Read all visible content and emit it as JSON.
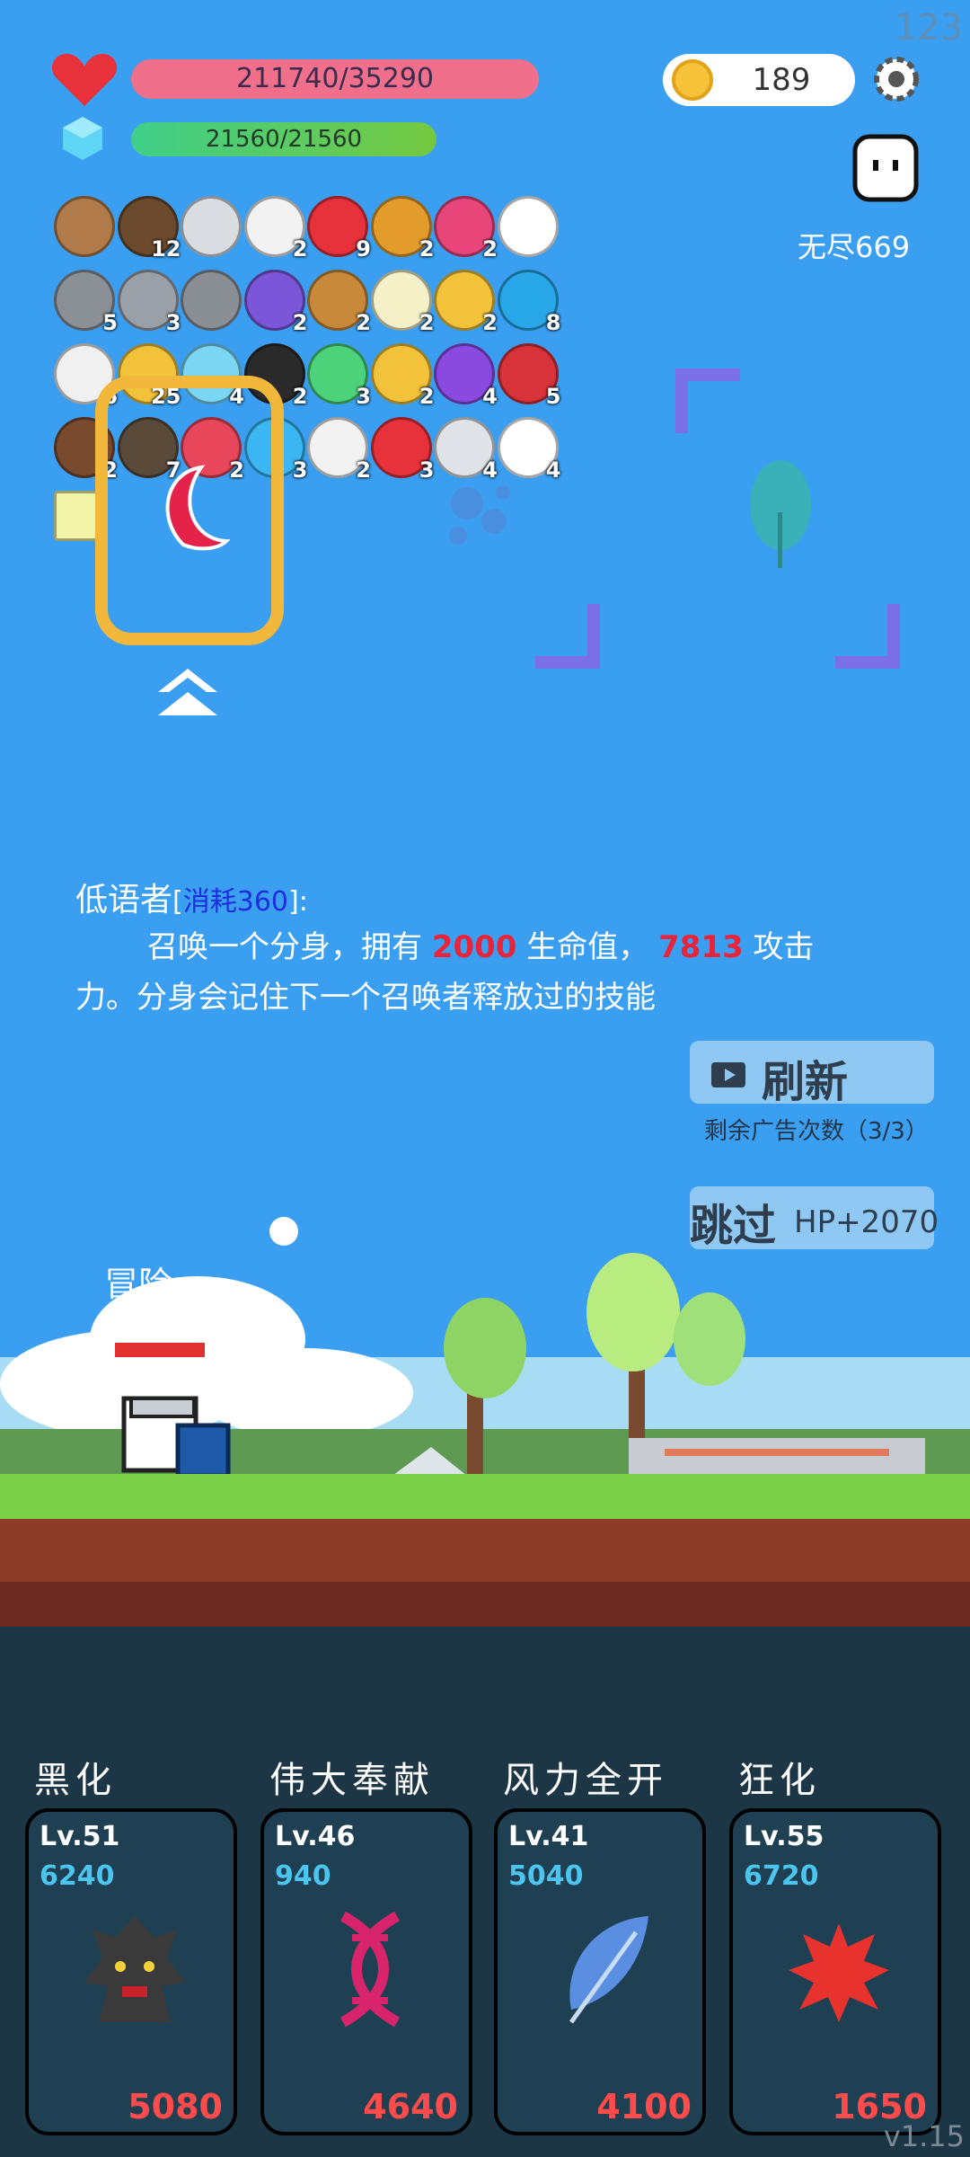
{
  "corner_number": "123",
  "hud": {
    "hp": "211740/35290",
    "mp": "21560/21560",
    "coins": "189",
    "endless": "无尽669"
  },
  "inventory": {
    "rows": [
      [
        {
          "icon": "shield-icon",
          "count": ""
        },
        {
          "icon": "coconut-icon",
          "count": "12"
        },
        {
          "icon": "sword-icon",
          "count": ""
        },
        {
          "icon": "envelope-icon",
          "count": "2"
        },
        {
          "icon": "strawberry-icon",
          "count": "9"
        },
        {
          "icon": "book-icon",
          "count": "2"
        },
        {
          "icon": "jam-jar-icon",
          "count": "2"
        },
        {
          "icon": "snowflake-icon",
          "count": ""
        }
      ],
      [
        {
          "icon": "tombstone-icon",
          "count": "5"
        },
        {
          "icon": "spiked-mace-icon",
          "count": "3"
        },
        {
          "icon": "helmet-icon",
          "count": ""
        },
        {
          "icon": "purple-chest-icon",
          "count": "2"
        },
        {
          "icon": "bow-icon",
          "count": "2"
        },
        {
          "icon": "lightbulb-icon",
          "count": "2"
        },
        {
          "icon": "gold-ring-icon",
          "count": "2"
        },
        {
          "icon": "blue-gem-icon",
          "count": "8"
        }
      ],
      [
        {
          "icon": "pill-icon",
          "count": "6"
        },
        {
          "icon": "sunflower-icon",
          "count": "25"
        },
        {
          "icon": "potion-icon",
          "count": "4"
        },
        {
          "icon": "black-pot-icon",
          "count": "2"
        },
        {
          "icon": "green-flask-icon",
          "count": "3"
        },
        {
          "icon": "magic-wand-icon",
          "count": "2"
        },
        {
          "icon": "crystal-ball-icon",
          "count": "4"
        },
        {
          "icon": "red-shield-icon",
          "count": "5"
        }
      ],
      [
        {
          "icon": "cake-icon",
          "count": "2"
        },
        {
          "icon": "arrows-icon",
          "count": "7"
        },
        {
          "icon": "watermelon-icon",
          "count": "2"
        },
        {
          "icon": "chat-bubble-icon",
          "count": "3"
        },
        {
          "icon": "dice-icon",
          "count": "2"
        },
        {
          "icon": "hearts-icon",
          "count": "3"
        },
        {
          "icon": "hook-icon",
          "count": "4"
        },
        {
          "icon": "ghost-icon",
          "count": "4"
        }
      ],
      [
        {
          "icon": "glowing-tile-icon",
          "count": ""
        }
      ]
    ]
  },
  "skill": {
    "name": "低语者",
    "cost_text": "消耗360",
    "line1_pre": "召唤一个分身，拥有 ",
    "hp_value": "2000",
    "line1_mid": " 生命值， ",
    "atk_value": "7813",
    "line1_post": " 攻击",
    "line2": "力。分身会记住下一个召唤者释放过的技能"
  },
  "actions": {
    "refresh_label": "刷新",
    "ad_count": "剩余广告次数（3/3）",
    "skip_label": "跳过",
    "skip_bonus": "HP+2070"
  },
  "scene": {
    "adventure_label": "冒险"
  },
  "cards": [
    {
      "name": "黑化",
      "level": "Lv.51",
      "cost": "6240",
      "damage": "5080",
      "icon": "dark-tree-icon"
    },
    {
      "name": "伟大奉献",
      "level": "Lv.46",
      "cost": "940",
      "damage": "4640",
      "icon": "dna-icon"
    },
    {
      "name": "风力全开",
      "level": "Lv.41",
      "cost": "5040",
      "damage": "4100",
      "icon": "feather-icon"
    },
    {
      "name": "狂化",
      "level": "Lv.55",
      "cost": "6720",
      "damage": "1650",
      "icon": "red-splat-icon"
    }
  ],
  "version": "v1.15",
  "colors": {
    "sky": "#3a9ff0",
    "hp_bar": "#f06f8b",
    "accent_red": "#e8233a",
    "cost_blue": "#4cc4f0"
  }
}
